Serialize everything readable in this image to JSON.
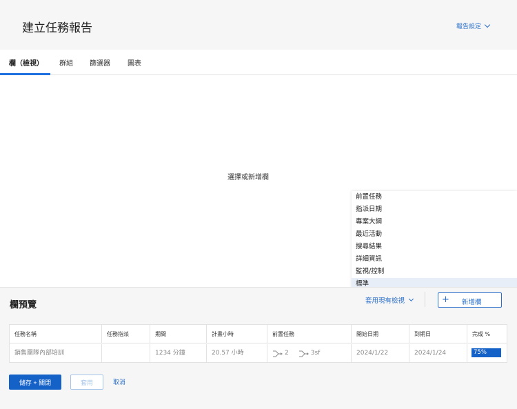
{
  "header": {
    "title": "建立任務報告",
    "report_settings": "報告設定"
  },
  "tabs": [
    {
      "label": "欄（檢視）",
      "active": true
    },
    {
      "label": "群組"
    },
    {
      "label": "篩選器"
    },
    {
      "label": "圖表"
    }
  ],
  "main": {
    "empty_text": "選擇或新增欄"
  },
  "dropdown": {
    "items": [
      "前置任務",
      "指派日期",
      "專案大綱",
      "最近活動",
      "搜尋結果",
      "詳細資訊",
      "監視/控制",
      "標準"
    ],
    "highlighted": "標準"
  },
  "preview": {
    "title": "欄預覽",
    "apply_view": "套用現有檢視",
    "add_column": "新增欄",
    "columns": [
      "任務名稱",
      "任務指派",
      "期間",
      "計畫小時",
      "前置任務",
      "開始日期",
      "到期日",
      "完成 %"
    ],
    "row": {
      "task_name": "銷售團隊內部培訓",
      "assignment": "",
      "duration": "1234 分鐘",
      "planned_hours": "20.57 小時",
      "predecessor_1": "2",
      "predecessor_2": "3sf",
      "start_date": "2024/1/22",
      "due_date": "2024/1/24",
      "percent_complete": "75%",
      "percent_value": 0.75
    }
  },
  "footer": {
    "save_close": "儲存 + 關閉",
    "apply": "套用",
    "cancel": "取消"
  },
  "colors": {
    "accent": "#1461c8",
    "link": "#2a6fc9",
    "highlight": "#e8eef7"
  }
}
